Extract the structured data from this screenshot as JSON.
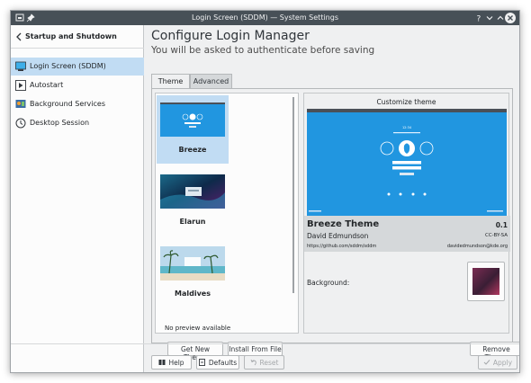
{
  "window": {
    "title": "Login Screen (SDDM) — System Settings"
  },
  "sidebar": {
    "back_label": "Startup and Shutdown",
    "items": [
      {
        "label": "Login Screen (SDDM)",
        "icon": "monitor-icon"
      },
      {
        "label": "Autostart",
        "icon": "autostart-icon"
      },
      {
        "label": "Background Services",
        "icon": "services-icon"
      },
      {
        "label": "Desktop Session",
        "icon": "session-icon"
      }
    ]
  },
  "main": {
    "title": "Configure Login Manager",
    "subtitle": "You will be asked to authenticate before saving",
    "tabs": [
      {
        "label": "Theme"
      },
      {
        "label": "Advanced"
      }
    ],
    "themes": [
      {
        "name": "Breeze"
      },
      {
        "name": "Elarun"
      },
      {
        "name": "Maldives"
      }
    ],
    "no_preview": "No preview available",
    "preview": {
      "caption": "Customize theme",
      "theme_name": "Breeze Theme",
      "version": "0.1",
      "author": "David Edmundson",
      "license": "CC-BY-SA",
      "url": "https://github.com/sddm/sddm",
      "email": "davidedmundson@kde.org",
      "background_label": "Background:"
    },
    "buttons": {
      "get_new": "Get New Theme",
      "install": "Install From File",
      "remove": "Remove Theme"
    }
  },
  "footer": {
    "help": "Help",
    "defaults": "Defaults",
    "reset": "Reset",
    "apply": "Apply"
  },
  "colors": {
    "titlebar": "#475057",
    "selection": "#c1dcf3",
    "accent": "#2196e0"
  }
}
